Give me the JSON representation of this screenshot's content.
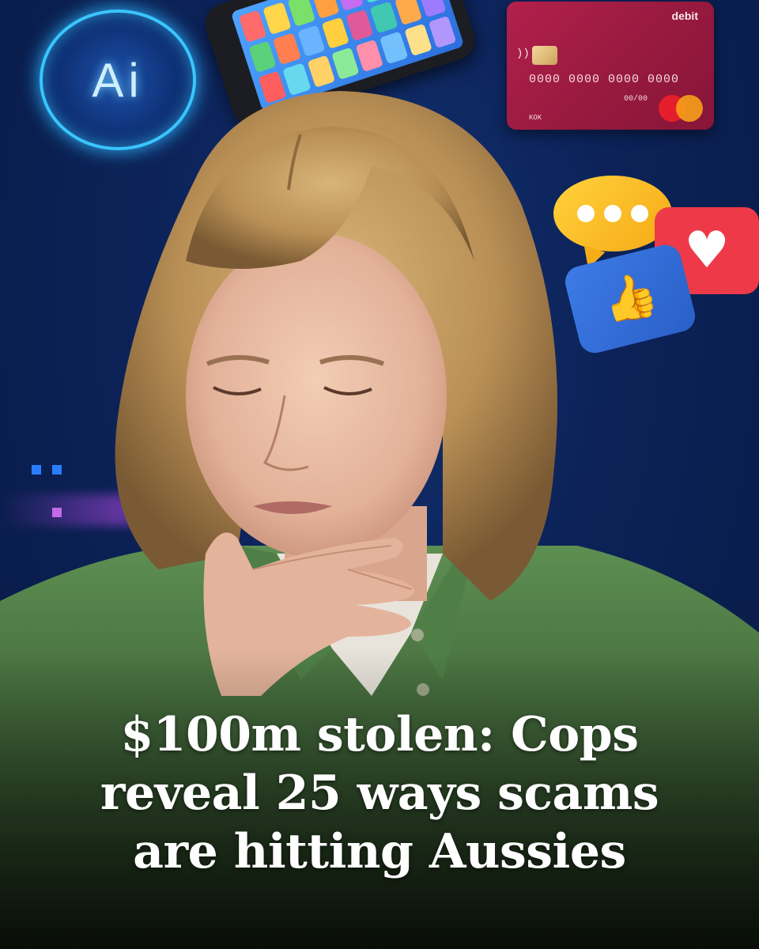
{
  "headline": {
    "line1": "$100m stolen: Cops",
    "line2": "reveal 25 ways scams",
    "line3": "are hitting Aussies"
  },
  "ai_badge": {
    "text": "Ai"
  },
  "card": {
    "brand": "debit",
    "number": "0000 0000 0000 0000",
    "expiry": "00/00",
    "holder": "KOK"
  },
  "icons": {
    "chat": "chat-bubble-icon",
    "heart": "heart-icon",
    "like": "thumbs-up-icon",
    "contactless": "contactless-icon",
    "card_network": "mastercard-logo"
  },
  "colors": {
    "background": "#0c2258",
    "ai_glow": "#39c6ff",
    "card": "#a21c45",
    "chat": "#ffd23c",
    "heart": "#ee3a48",
    "like": "#3d7be6",
    "shirt": "#4f7f47",
    "hair": "#c9a165"
  }
}
